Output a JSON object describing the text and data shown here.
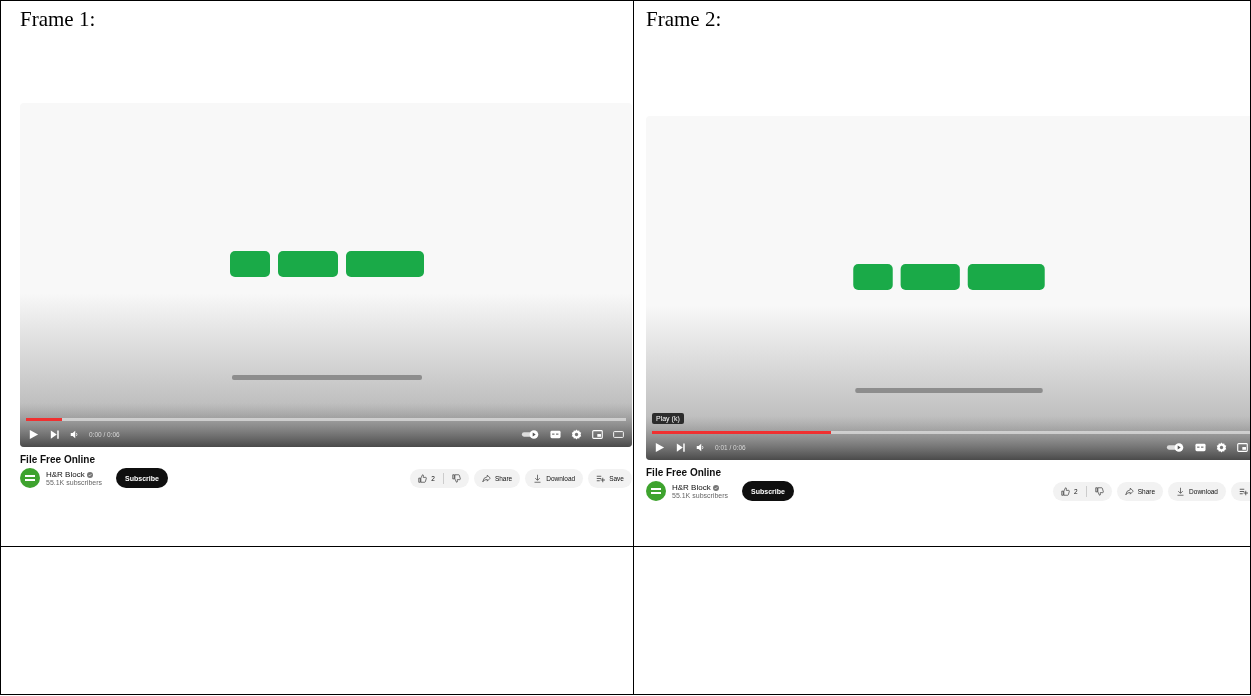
{
  "frames": [
    {
      "label": "Frame 1:",
      "player": {
        "kind": "picture",
        "progress": {
          "level": 0.06
        },
        "time": "0:00 / 0:06",
        "left_controls": [
          {
            "kind": "play"
          },
          {
            "kind": "next"
          },
          {
            "kind": "volume"
          }
        ],
        "right_controls": [
          {
            "kind": "autoplay"
          },
          {
            "kind": "captions"
          },
          {
            "kind": "settings"
          },
          {
            "kind": "miniplayer"
          },
          {
            "kind": "theater"
          }
        ]
      },
      "video_title": "File Free Online",
      "channel": {
        "name": "H&R Block",
        "verified": true,
        "subscribers": "55.1K subscribers"
      },
      "subscribe": "Subscribe",
      "actions": [
        {
          "kind": "like",
          "label": "2"
        },
        {
          "kind": "dislike"
        },
        {
          "kind": "share",
          "label": "Share"
        },
        {
          "kind": "download",
          "label": "Download"
        },
        {
          "kind": "save",
          "label": "Save"
        }
      ]
    },
    {
      "label": "Frame 2:",
      "player": {
        "kind": "picture",
        "tooltip": "Play (k)",
        "progress": {
          "level": 0.3
        },
        "time": "0:01 / 0:06",
        "left_controls": [
          {
            "kind": "play"
          },
          {
            "kind": "next"
          },
          {
            "kind": "volume"
          }
        ],
        "right_controls": [
          {
            "kind": "autoplay"
          },
          {
            "kind": "captions"
          },
          {
            "kind": "settings"
          },
          {
            "kind": "miniplayer"
          }
        ]
      },
      "video_title": "File Free Online",
      "channel": {
        "name": "H&R Block",
        "verified": true,
        "subscribers": "55.1K subscribers"
      },
      "subscribe": "Subscribe",
      "actions": [
        {
          "kind": "like",
          "label": "2"
        },
        {
          "kind": "dislike"
        },
        {
          "kind": "share",
          "label": "Share"
        },
        {
          "kind": "download",
          "label": "Download"
        },
        {
          "kind": "save"
        }
      ]
    }
  ]
}
